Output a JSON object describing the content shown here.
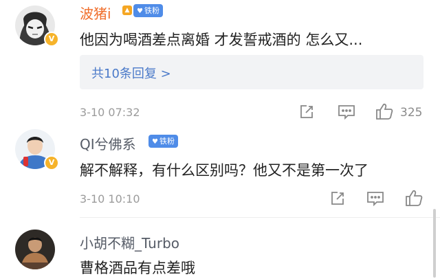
{
  "comments": [
    {
      "username": "波猪i",
      "fan_badge": "铁粉",
      "text": "他因为喝酒差点离婚 才发誓戒酒的 怎么又...",
      "replies_label": "共10条回复 >",
      "timestamp": "3-10 07:32",
      "like_count": "325",
      "verified_badge": "V"
    },
    {
      "username": "QI兮佛系",
      "fan_badge": "铁粉",
      "text": "解不解释，有什么区别吗？他又不是第一次了",
      "timestamp": "3-10 10:10",
      "verified_badge": "V"
    },
    {
      "username": "小胡不糊_Turbo",
      "text": "曹格酒品有点差哦"
    }
  ],
  "colors": {
    "accent_orange": "#f06e2b",
    "link_blue": "#4b7ac9",
    "fan_badge_blue": "#4f8ce8",
    "verified_gold": "#f6b32a"
  },
  "icons": [
    "share-icon",
    "comment-icon",
    "like-icon"
  ]
}
